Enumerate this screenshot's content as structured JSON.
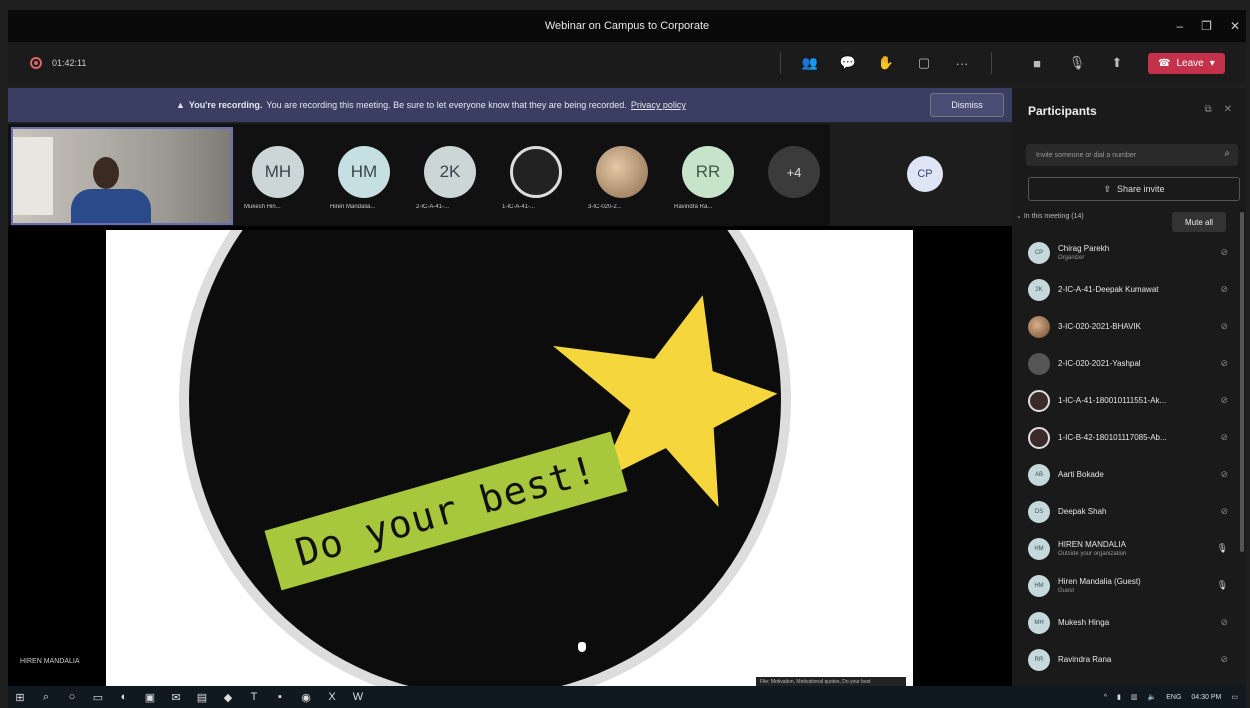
{
  "window": {
    "title": "Webinar on Campus to Corporate",
    "min": "–",
    "max": "❐",
    "close": "✕"
  },
  "meeting": {
    "timer": "01:42:11"
  },
  "toolbar": {
    "leave_label": "Leave"
  },
  "banner": {
    "lead": "You're recording.",
    "text": "You are recording this meeting. Be sure to let everyone know that they are being recorded.",
    "link": "Privacy policy",
    "dismiss": "Dismiss"
  },
  "gallery": {
    "tiles": [
      {
        "initials": "MH",
        "name": "Mukesh Hin...",
        "style": "grey"
      },
      {
        "initials": "HM",
        "name": "Hiren Mandalia...",
        "style": ""
      },
      {
        "initials": "2K",
        "name": "2-IC-A-41-...",
        "style": "grey"
      },
      {
        "initials": "",
        "name": "1-IC-A-41-...",
        "style": "photo1"
      },
      {
        "initials": "",
        "name": "3-IC-020-2...",
        "style": "photo2"
      },
      {
        "initials": "RR",
        "name": "Ravindra Ra...",
        "style": "green"
      },
      {
        "initials": "+4",
        "name": "",
        "style": "more"
      }
    ],
    "presenter_initials": "CP"
  },
  "stage": {
    "slide_text": "Do your best!",
    "speaker_label": "HIREN MANDALIA",
    "credit": "File: Motivation, Motivational quotes, Do your best"
  },
  "participants": {
    "title": "Participants",
    "invite_placeholder": "Invite someone or dial a number",
    "share_invite": "Share invite",
    "section_label": "In this meeting (14)",
    "mute_all": "Mute all",
    "list": [
      {
        "initials": "CP",
        "name": "Chirag Parekh",
        "role": "Organizer",
        "av": "",
        "mic": "muted"
      },
      {
        "initials": "2K",
        "name": "2-IC-A-41-Deepak Kumawat",
        "role": "",
        "av": "",
        "mic": "muted"
      },
      {
        "initials": "",
        "name": "3-IC-020-2021-BHAVIK",
        "role": "",
        "av": "img1",
        "mic": "muted"
      },
      {
        "initials": "",
        "name": "2-IC-020-2021-Yashpal",
        "role": "",
        "av": "img2",
        "mic": "muted"
      },
      {
        "initials": "",
        "name": "1-IC-A-41-180010111551-Ak...",
        "role": "",
        "av": "img3",
        "mic": "muted"
      },
      {
        "initials": "",
        "name": "1-IC-B-42-180101117085-Ab...",
        "role": "",
        "av": "img3",
        "mic": "muted"
      },
      {
        "initials": "AB",
        "name": "Aarti Bokade",
        "role": "",
        "av": "",
        "mic": "muted"
      },
      {
        "initials": "DS",
        "name": "Deepak Shah",
        "role": "",
        "av": "",
        "mic": "muted"
      },
      {
        "initials": "HM",
        "name": "HIREN MANDALIA",
        "role": "Outside your organization",
        "av": "",
        "mic": "on"
      },
      {
        "initials": "HM",
        "name": "Hiren Mandalia (Guest)",
        "role": "Guest",
        "av": "",
        "mic": "on"
      },
      {
        "initials": "MH",
        "name": "Mukesh Hinga",
        "role": "",
        "av": "",
        "mic": "muted"
      },
      {
        "initials": "RR",
        "name": "Ravindra Rana",
        "role": "",
        "av": "",
        "mic": "muted"
      }
    ]
  },
  "taskbar": {
    "lang": "ENG",
    "time": "04:30 PM"
  }
}
